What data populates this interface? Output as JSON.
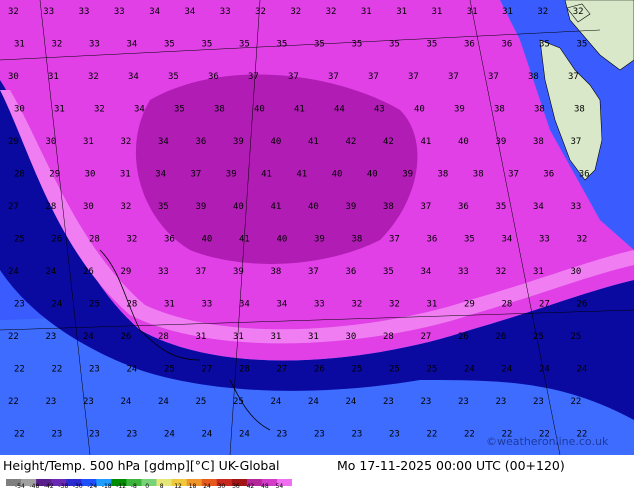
{
  "map": {
    "field": "Height/Temp. 500 hPa",
    "grid_values_rows": [
      "32 33 33 33 34 34 33 32 32 32 31 31 31 31 31 32 32",
      "31 32 33 34 35 35 35 35 35 35 35 35 36 36 35 35",
      "30 31 32 34 35 36 37 37 37 37 37 37 37 38 37",
      "30 31 32 34 35 38 40 41 44 43 40 39 38 38 38",
      "29 30 31 32 34 36 39 40 41 42 42 41 40 39 38 37",
      "28 29 30 31 34 37 39 41 41 40 40 39 38 38 37 36 36",
      "27 28 30 32 35 39 40 41 40 39 38 37 36 35 34 33",
      "25 26 28 32 36 40 41 40 39 38 37 36 35 34 33 32",
      "24 24 26 29 33 37 39 38 37 36 35 34 33 32 31 30",
      "23 24 25 28 31 33 34 34 33 32 32 31 29 28 27 26",
      "22 23 24 26 28 31 31 31 31 30 28 27 26 26 25 25",
      "22 22 23 24 25 27 28 27 26 25 25 25 24 24 24 24",
      "22 23 23 24 24 25 25 24 24 24 23 23 23 23 23 22",
      "22 23 23 23 24 24 24 23 23 23 23 22 22 22 22 22"
    ],
    "colors": {
      "deep_blue": "#1e1eb4",
      "navy": "#0a0aa0",
      "blue": "#3a5cff",
      "light_blue": "#4a7cff",
      "magenta": "#e040e6",
      "pink": "#f07ef2",
      "purple": "#b01cb4",
      "land": "#d8e8c8"
    }
  },
  "footer": {
    "title_left": "Height/Temp. 500 hPa [gdmp][°C] UK-Global",
    "title_right": "Mo 17-11-2025 00:00 UTC (00+120)",
    "credit": "©weatheronline.co.uk",
    "colorbar_labels": [
      "-54",
      "-48",
      "-42",
      "-38",
      "-30",
      "-24",
      "-18",
      "-12",
      "-8",
      "0",
      "8",
      "12",
      "18",
      "24",
      "30",
      "36",
      "42",
      "48",
      "54"
    ],
    "colorbar_colors": [
      "#7f7f7f",
      "#a0a0a0",
      "#5a1e8c",
      "#6a2ab4",
      "#2a2ad0",
      "#1e50ff",
      "#1e9cff",
      "#008c00",
      "#3cb43c",
      "#78d278",
      "#e6e678",
      "#f0c83c",
      "#f09628",
      "#e65a1e",
      "#c8281e",
      "#a01414",
      "#b4289c",
      "#d23cc8",
      "#f06ef0"
    ]
  }
}
